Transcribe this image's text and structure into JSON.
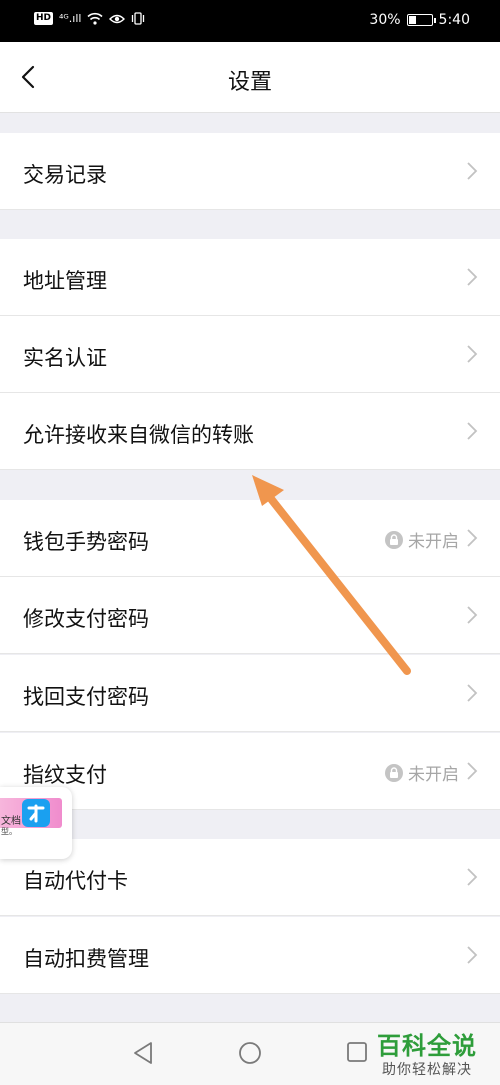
{
  "status_bar": {
    "hd": "HD",
    "signal": "⁴ᴳ.ıll",
    "battery_percent": "30%",
    "battery_level": 0.3,
    "time": "5:40"
  },
  "header": {
    "title": "设置"
  },
  "rows": [
    {
      "label": "交易记录"
    },
    {
      "label": "地址管理"
    },
    {
      "label": "实名认证"
    },
    {
      "label": "允许接收来自微信的转账"
    },
    {
      "label": "钱包手势密码",
      "status": "未开启"
    },
    {
      "label": "修改支付密码"
    },
    {
      "label": "找回支付密码"
    },
    {
      "label": "指纹支付",
      "status": "未开启"
    },
    {
      "label": "自动代付卡"
    },
    {
      "label": "自动扣费管理"
    }
  ],
  "float_widget": {
    "text_top": "文档",
    "text_bottom": "型。"
  },
  "watermark": {
    "title": "百科全说",
    "subtitle": "助你轻松解决"
  },
  "colors": {
    "annotation_arrow": "#f0964e",
    "watermark_green": "#2e9d3a"
  }
}
